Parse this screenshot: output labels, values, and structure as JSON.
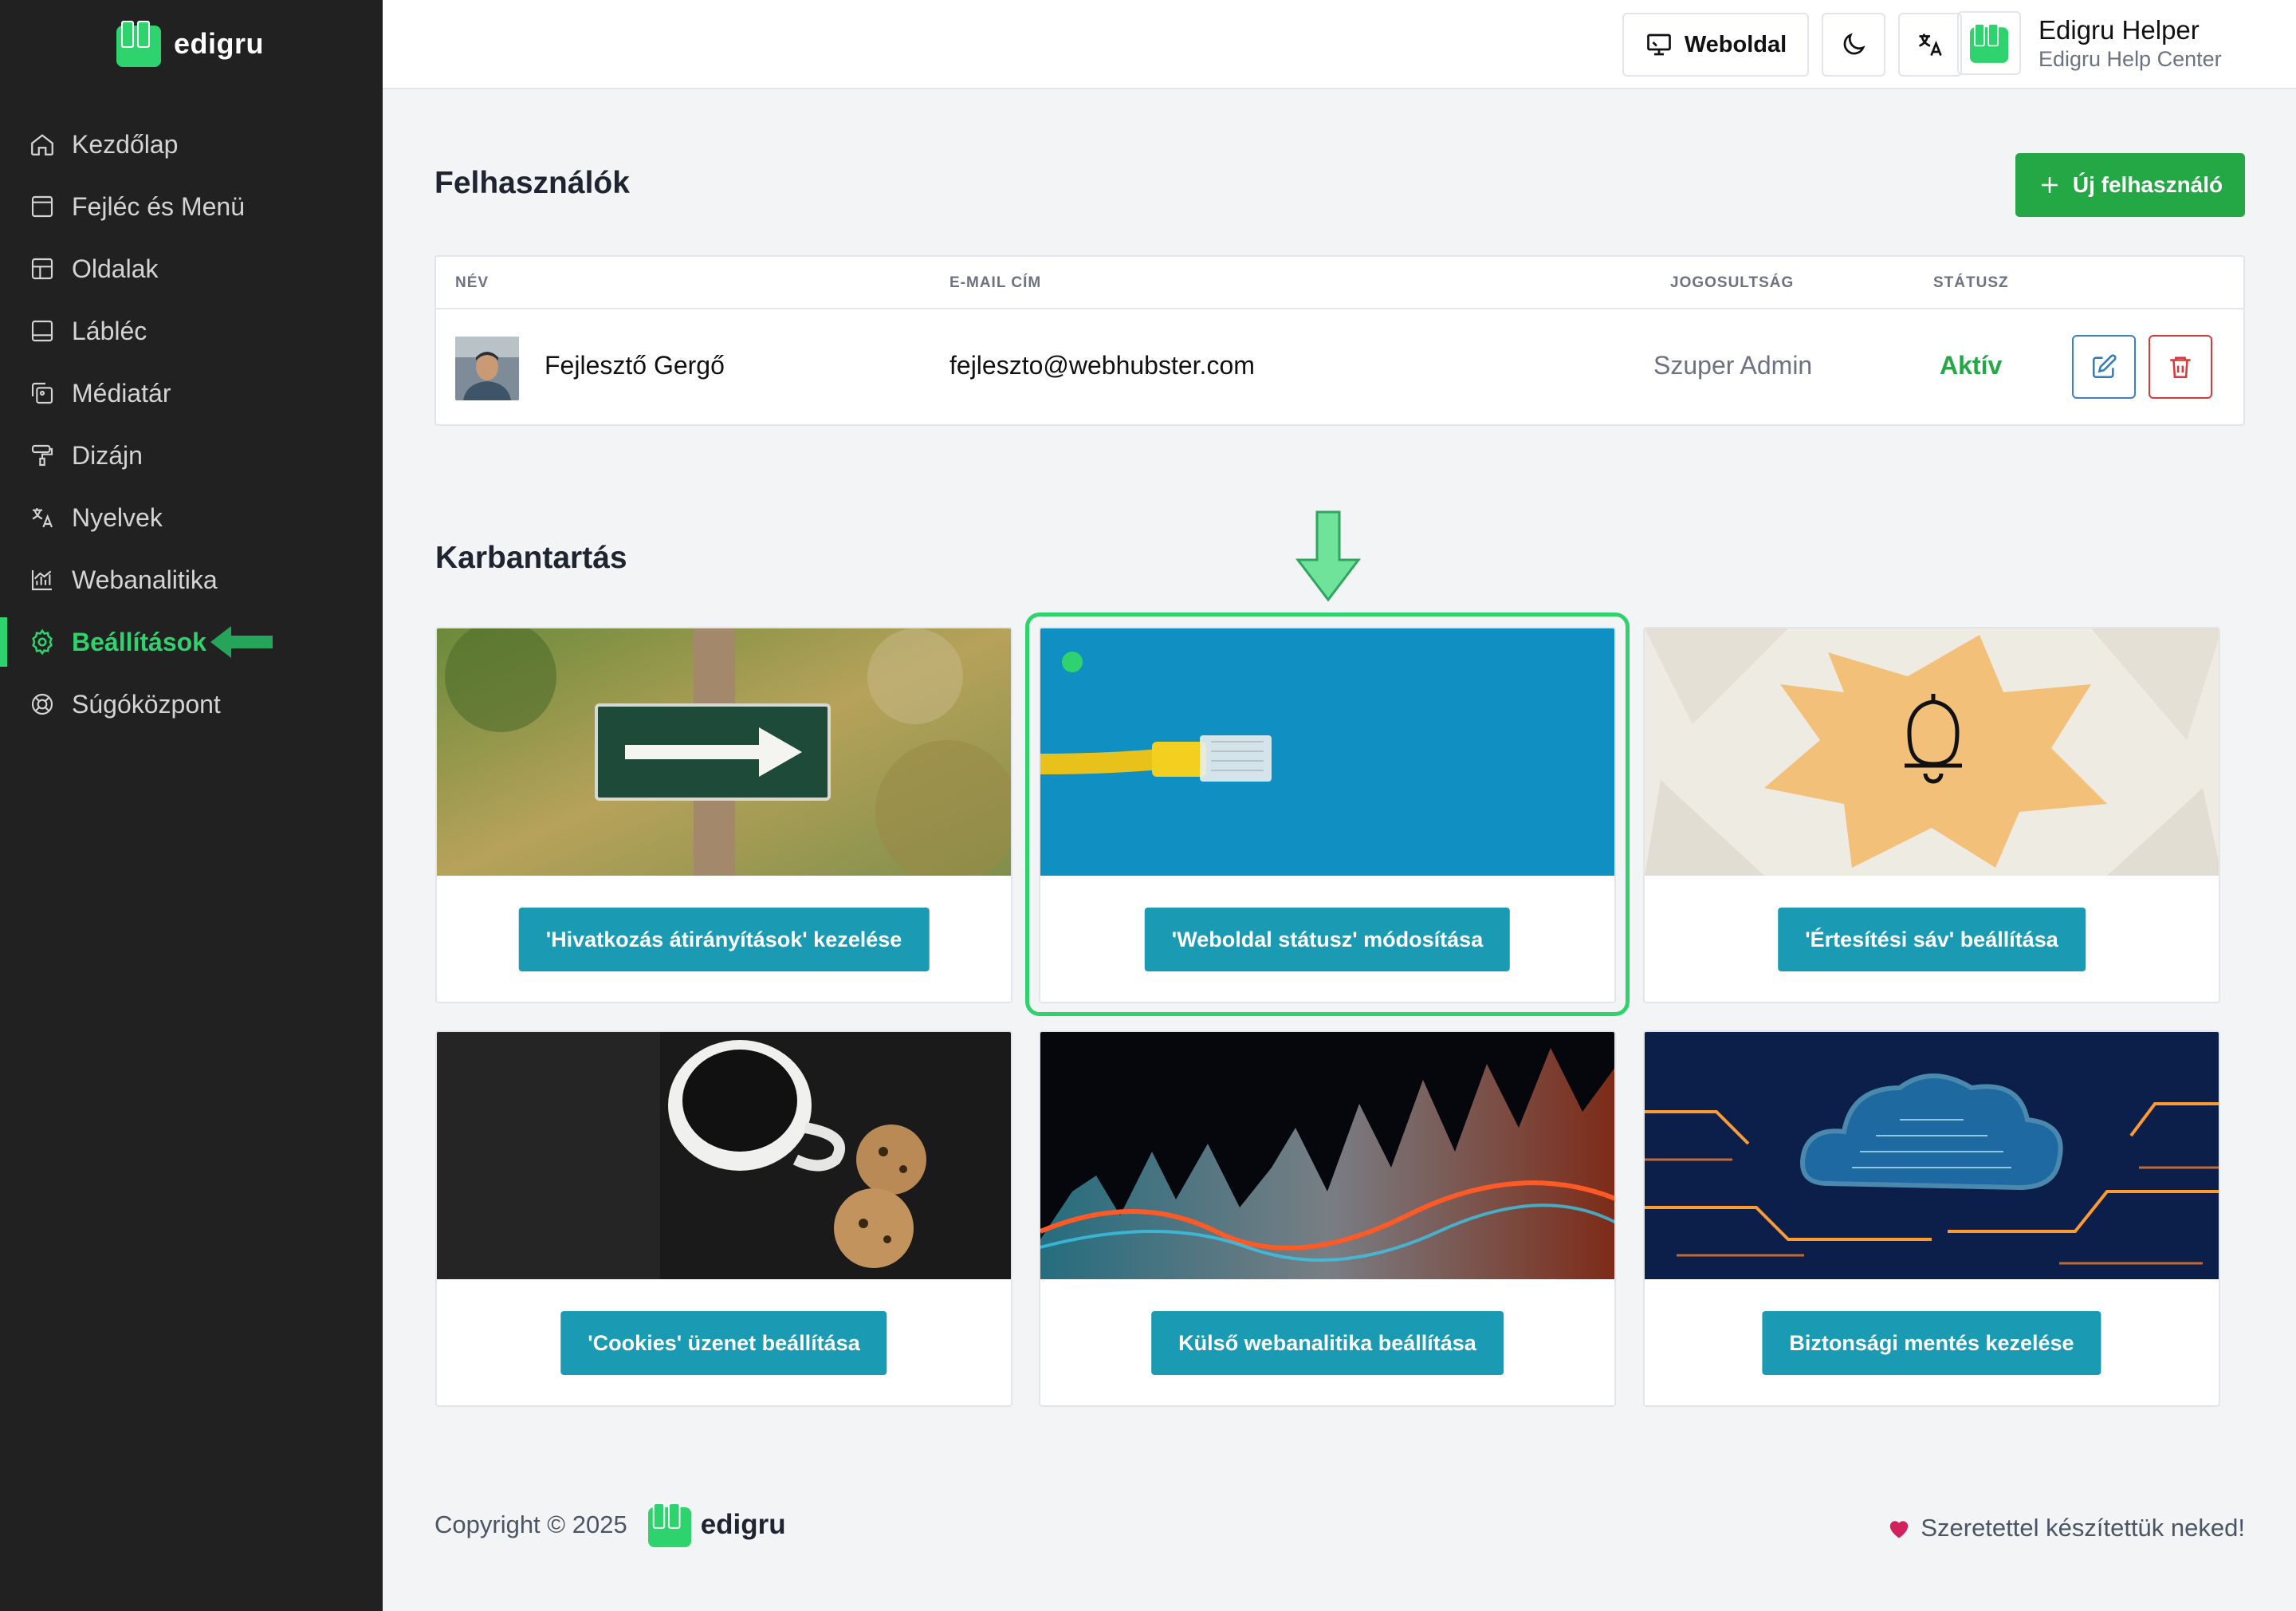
{
  "brand": {
    "name": "edigru",
    "accent": "#2ed36d"
  },
  "sidebar": {
    "items": [
      {
        "label": "Kezdőlap",
        "icon": "home-icon"
      },
      {
        "label": "Fejléc és Menü",
        "icon": "layout-icon"
      },
      {
        "label": "Oldalak",
        "icon": "pages-icon"
      },
      {
        "label": "Lábléc",
        "icon": "footer-icon"
      },
      {
        "label": "Médiatár",
        "icon": "media-icon"
      },
      {
        "label": "Dizájn",
        "icon": "paint-roller-icon"
      },
      {
        "label": "Nyelvek",
        "icon": "translate-icon"
      },
      {
        "label": "Webanalitika",
        "icon": "chart-icon"
      },
      {
        "label": "Beállítások",
        "icon": "gear-icon",
        "active": true
      },
      {
        "label": "Súgóközpont",
        "icon": "lifebuoy-icon"
      }
    ]
  },
  "header": {
    "website_button": "Weboldal",
    "user_name": "Edigru Helper",
    "user_subtitle": "Edigru Help Center"
  },
  "users": {
    "title": "Felhasználók",
    "new_button": "Új felhasználó",
    "columns": [
      "NÉV",
      "E-MAIL CÍM",
      "JOGOSULTSÁG",
      "STÁTUSZ"
    ],
    "rows": [
      {
        "name": "Fejlesztő Gergő",
        "email": "fejleszto@webhubster.com",
        "role": "Szuper Admin",
        "status": "Aktív"
      }
    ]
  },
  "maintenance": {
    "title": "Karbantartás",
    "cards": [
      {
        "label": "'Hivatkozás átirányítások' kezelése",
        "image": "arrow-sign-photo"
      },
      {
        "label": "'Weboldal státusz' módosítása",
        "image": "network-cable-photo",
        "highlighted": true
      },
      {
        "label": "'Értesítési sáv' beállítása",
        "image": "bell-envelopes-photo"
      },
      {
        "label": "'Cookies' üzenet beállítása",
        "image": "coffee-cookies-photo"
      },
      {
        "label": "Külső webanalitika beállítása",
        "image": "data-waves-photo"
      },
      {
        "label": "Biztonsági mentés kezelése",
        "image": "cloud-circuit-photo"
      }
    ]
  },
  "footer": {
    "copyright": "Copyright © 2025",
    "brand": "edigru",
    "tagline": "Szeretettel készítettük neked!"
  }
}
